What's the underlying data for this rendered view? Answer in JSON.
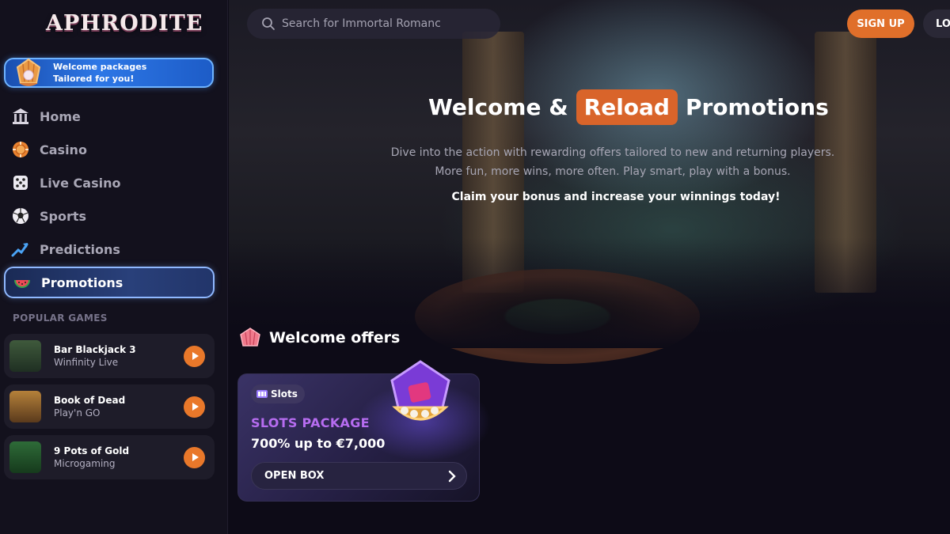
{
  "brand": {
    "logo_text": "APHRODITE"
  },
  "welcome_banner": {
    "line1": "Welcome packages",
    "line2": "Tailored for you!"
  },
  "nav": {
    "items": [
      {
        "label": "Home",
        "icon": "temple-icon"
      },
      {
        "label": "Casino",
        "icon": "chip-icon"
      },
      {
        "label": "Live Casino",
        "icon": "dice-icon"
      },
      {
        "label": "Sports",
        "icon": "soccer-ball-icon"
      },
      {
        "label": "Predictions",
        "icon": "trend-arrow-icon"
      },
      {
        "label": "Promotions",
        "icon": "watermelon-icon",
        "active": true
      }
    ]
  },
  "popular": {
    "title": "POPULAR GAMES",
    "games": [
      {
        "name": "Bar Blackjack 3",
        "provider": "Winfinity Live"
      },
      {
        "name": "Book of Dead",
        "provider": "Play'n GO"
      },
      {
        "name": "9 Pots of Gold",
        "provider": "Microgaming"
      }
    ]
  },
  "header": {
    "search_placeholder": "Search for Immortal Romanc",
    "signup_label": "SIGN UP",
    "login_label": "LO"
  },
  "hero": {
    "title_pre": "Welcome &",
    "title_highlight": "Reload",
    "title_post": "Promotions",
    "description": "Dive into the action with rewarding offers tailored to new and returning players. More fun, more wins, more often. Play smart, play with a bonus.",
    "cta": "Claim your bonus and increase your winnings today!"
  },
  "welcome_offers": {
    "title": "Welcome offers",
    "cards": [
      {
        "tag": "Slots",
        "package": "SLOTS PACKAGE",
        "amount": "700% up to €7,000",
        "button": "OPEN BOX"
      }
    ]
  },
  "colors": {
    "accent": "#e06f2a",
    "active_border": "#8fb8ff",
    "package_purple": "#b66cf0"
  }
}
